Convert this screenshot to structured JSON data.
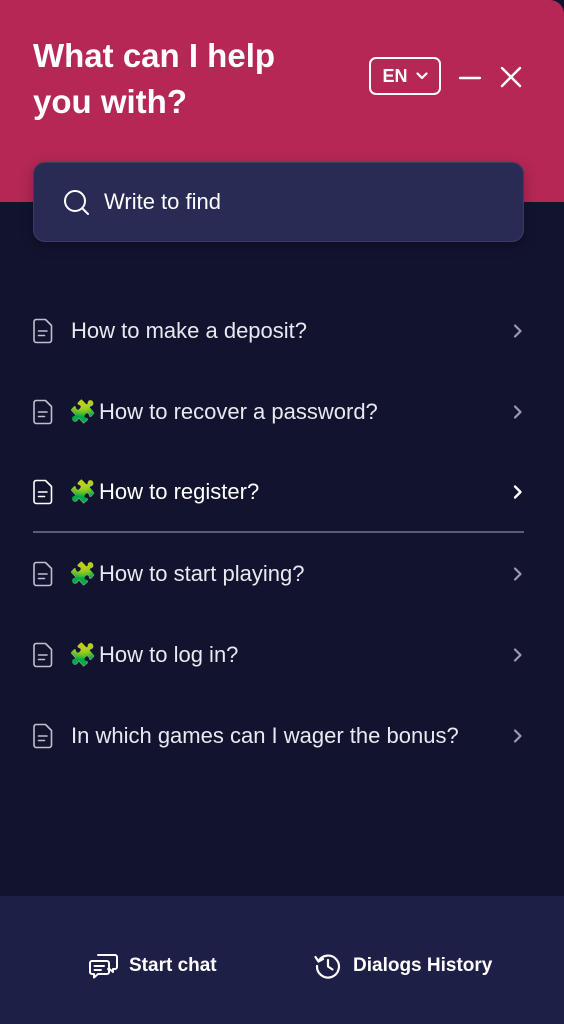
{
  "header": {
    "title": "What can I help you with?",
    "language": "EN"
  },
  "search": {
    "placeholder": "Write to find"
  },
  "faq": [
    {
      "label": "How to make a deposit?",
      "emoji": ""
    },
    {
      "label": "How to recover a password?",
      "emoji": "🧩"
    },
    {
      "label": "How to register?",
      "emoji": "🧩"
    },
    {
      "label": "How to start playing?",
      "emoji": "🧩"
    },
    {
      "label": "How to log in?",
      "emoji": "🧩"
    },
    {
      "label": "In which games can I wager the bonus?",
      "emoji": ""
    }
  ],
  "footer": {
    "start_chat": "Start chat",
    "dialogs_history": "Dialogs History"
  },
  "colors": {
    "header_bg": "#b52755",
    "body_bg": "#12132e",
    "search_bg": "#2a2b55",
    "footer_bg": "#1e1f46"
  },
  "icons": {
    "search": "search-icon",
    "language_chevron": "chevron-down-icon",
    "minimize": "minimize-icon",
    "close": "close-icon",
    "document": "document-icon",
    "puzzle": "puzzle-piece-emoji",
    "chevron_right": "chevron-right-icon",
    "chat": "chat-bubbles-icon",
    "history": "history-clock-icon"
  }
}
